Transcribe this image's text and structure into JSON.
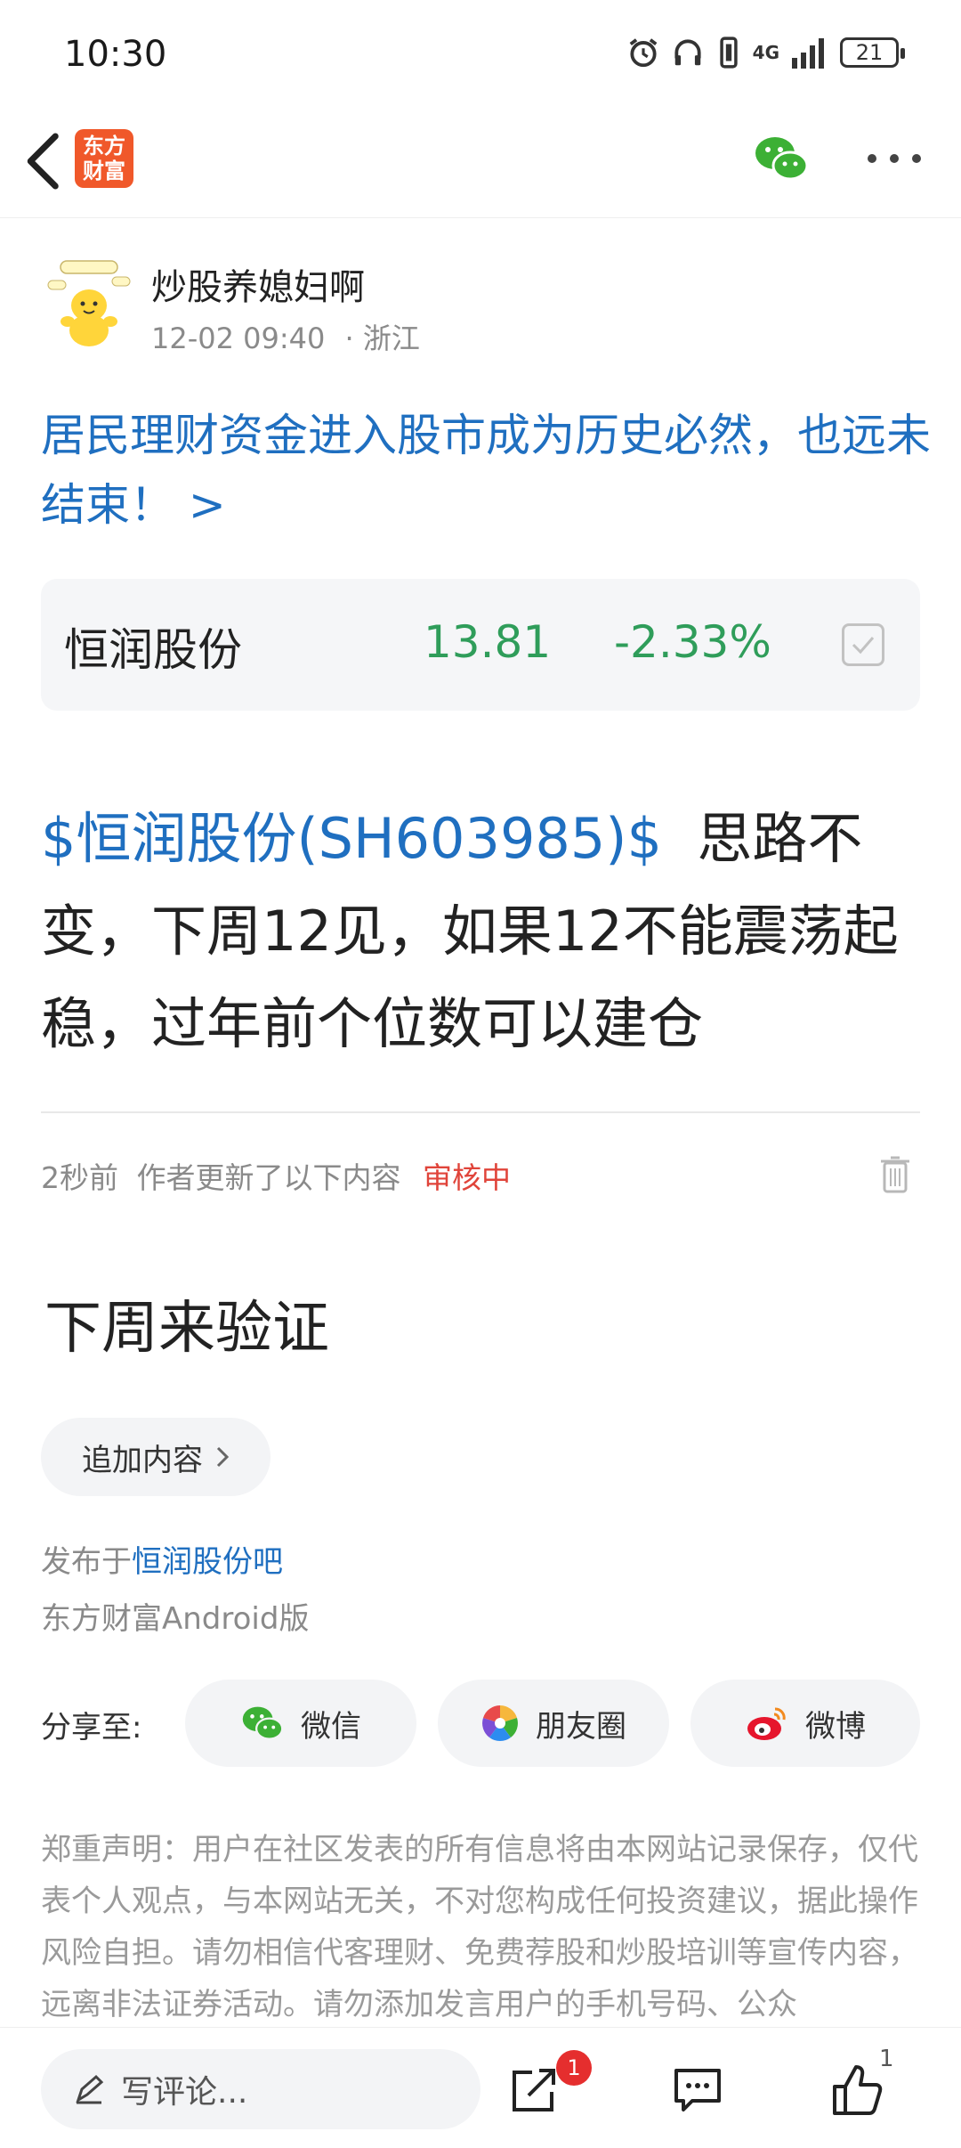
{
  "status": {
    "time": "10:30",
    "battery": "21",
    "network": "4G"
  },
  "nav": {
    "logo_line1": "东方",
    "logo_line2": "财富"
  },
  "author": {
    "name": "炒股养媳妇啊",
    "time": "12-02 09:40",
    "location": "· 浙江"
  },
  "title_link": "居民理财资金进入股市成为历史必然，也远未结束！ >",
  "stock": {
    "name": "恒润股份",
    "price": "13.81",
    "change": "-2.33%"
  },
  "post": {
    "tag": "$恒润股份(SH603985)$",
    "content": "思路不变，下周12见，如果12不能震荡起稳，过年前个位数可以建仓"
  },
  "update": {
    "time": "2秒前",
    "text": "作者更新了以下内容",
    "status": "审核中"
  },
  "sub_content": "下周来验证",
  "append_button": "追加内容",
  "publish": {
    "prefix": "发布于",
    "forum": "恒润股份吧",
    "client": "东方财富Android版"
  },
  "share": {
    "label": "分享至:",
    "wechat": "微信",
    "moments": "朋友圈",
    "weibo": "微博"
  },
  "disclaimer": "郑重声明：用户在社区发表的所有信息将由本网站记录保存，仅代表个人观点，与本网站无关，不对您构成任何投资建议，据此操作风险自担。请勿相信代客理财、免费荐股和炒股培训等宣传内容，远离非法证券活动。请勿添加发言用户的手机号码、公众",
  "bottom": {
    "comment_placeholder": "写评论...",
    "share_badge": "1",
    "like_count": "1"
  },
  "colors": {
    "link": "#1f6fc0",
    "down": "#2f9d5a",
    "review": "#e0443a",
    "brand": "#f0582a"
  }
}
